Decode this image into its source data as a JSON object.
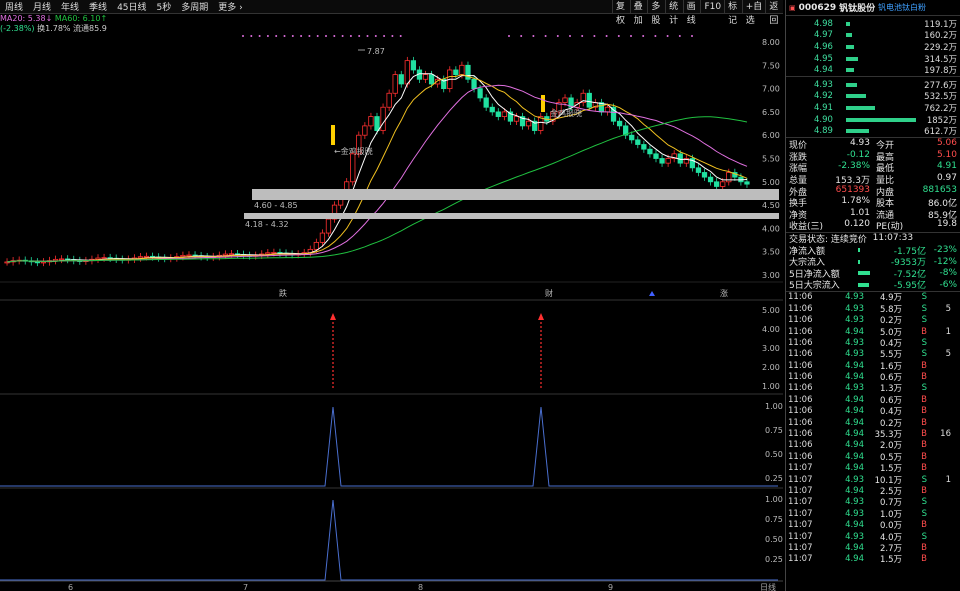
{
  "toolbar": {
    "periods": [
      "周线",
      "月线",
      "年线",
      "季线",
      "45日线",
      "5秒",
      "多周期",
      "更多 ›"
    ],
    "right": [
      "复权",
      "叠加",
      "多股",
      "统计",
      "画线",
      "F10",
      "标记",
      "+自选",
      "返回"
    ]
  },
  "ma": {
    "ma20": "MA20: 5.38↓",
    "ma60": "MA60: 6.10↑",
    "line2a": "(-2.38%)",
    "line2b": "换1.78% 流通85.9"
  },
  "chart": {
    "price_axis": [
      "8.00",
      "7.50",
      "7.00",
      "6.50",
      "6.00",
      "5.50",
      "5.00",
      "4.50",
      "4.00",
      "3.50",
      "3.00"
    ],
    "x_labels": [
      "6",
      "7",
      "8",
      "9"
    ],
    "annot": {
      "hi": "7.87",
      "box1": "4.60 - 4.85",
      "box2": "4.18 - 4.32",
      "sig1": "←金鸡报晓",
      "sig2": "金鸡报晓"
    },
    "events": {
      "e1": "跌",
      "e2": "财",
      "e3": "涨"
    },
    "sub1_axis": [
      "5.00",
      "4.00",
      "3.00",
      "2.00",
      "1.00"
    ],
    "sub2_axis": [
      "1.00",
      "0.75",
      "0.50",
      "0.25"
    ],
    "sub3_axis": [
      "1.00",
      "0.75",
      "0.50",
      "0.25"
    ],
    "bottom_label": "日线"
  },
  "colors": {
    "up": "#ff3030",
    "down": "#20e0a0",
    "ma5": "#ffffff",
    "ma10": "#f0c020",
    "ma20": "#e070e0",
    "ma60": "#20c040",
    "signal": "#ffd000",
    "box": "#bdbdbd",
    "line": "#4a6fd0"
  },
  "quote": {
    "code": "000629",
    "name": "钒钛股份",
    "tag": "钒电池钛白粉",
    "sells": [
      {
        "p": "4.98",
        "v": "119.1万",
        "w": 0.06
      },
      {
        "p": "4.97",
        "v": "160.2万",
        "w": 0.08
      },
      {
        "p": "4.96",
        "v": "229.2万",
        "w": 0.12
      },
      {
        "p": "4.95",
        "v": "314.5万",
        "w": 0.17
      },
      {
        "p": "4.94",
        "v": "197.8万",
        "w": 0.11
      }
    ],
    "buys": [
      {
        "p": "4.93",
        "v": "277.6万",
        "w": 0.15
      },
      {
        "p": "4.92",
        "v": "532.5万",
        "w": 0.29
      },
      {
        "p": "4.91",
        "v": "762.2万",
        "w": 0.41
      },
      {
        "p": "4.90",
        "v": "1852万",
        "w": 1.0
      },
      {
        "p": "4.89",
        "v": "612.7万",
        "w": 0.33
      }
    ],
    "stats": [
      [
        "现价",
        "4.93",
        "今开",
        "5.06"
      ],
      [
        "涨跌",
        "-0.12",
        "最高",
        "5.10"
      ],
      [
        "涨幅",
        "-2.38%",
        "最低",
        "4.91"
      ],
      [
        "总量",
        "153.3万",
        "量比",
        "0.97"
      ],
      [
        "外盘",
        "651393",
        "内盘",
        "881653"
      ],
      [
        "换手",
        "1.78%",
        "股本",
        "86.0亿"
      ],
      [
        "净资",
        "1.01",
        "流通",
        "85.9亿"
      ],
      [
        "收益(三)",
        "0.120",
        "PE(动)",
        "19.8"
      ]
    ],
    "trade_state": "交易状态: 连续竞价",
    "trade_time": "11:07:33",
    "flows": [
      [
        "净流入额",
        "-1.75亿",
        "-23%",
        0.1
      ],
      [
        "大宗流入",
        "-9353万",
        "-12%",
        0.05
      ],
      [
        "5日净流入额",
        "-7.52亿",
        "-8%",
        0.6
      ],
      [
        "5日大宗流入",
        "-5.95亿",
        "-6%",
        0.55
      ]
    ],
    "ticks": [
      [
        "11:06",
        "4.93",
        "4.9万",
        "S",
        ""
      ],
      [
        "11:06",
        "4.93",
        "5.8万",
        "S",
        "5"
      ],
      [
        "11:06",
        "4.93",
        "0.2万",
        "S",
        ""
      ],
      [
        "11:06",
        "4.94",
        "5.0万",
        "B",
        "1"
      ],
      [
        "11:06",
        "4.93",
        "0.4万",
        "S",
        ""
      ],
      [
        "11:06",
        "4.93",
        "5.5万",
        "S",
        "5"
      ],
      [
        "11:06",
        "4.94",
        "1.6万",
        "B",
        ""
      ],
      [
        "11:06",
        "4.94",
        "0.6万",
        "B",
        ""
      ],
      [
        "11:06",
        "4.93",
        "1.3万",
        "S",
        ""
      ],
      [
        "11:06",
        "4.94",
        "0.6万",
        "B",
        ""
      ],
      [
        "11:06",
        "4.94",
        "0.4万",
        "B",
        ""
      ],
      [
        "11:06",
        "4.94",
        "0.2万",
        "B",
        ""
      ],
      [
        "11:06",
        "4.94",
        "35.3万",
        "B",
        "16"
      ],
      [
        "11:06",
        "4.94",
        "2.0万",
        "B",
        ""
      ],
      [
        "11:06",
        "4.94",
        "0.5万",
        "B",
        ""
      ],
      [
        "11:07",
        "4.94",
        "1.5万",
        "B",
        ""
      ],
      [
        "11:07",
        "4.93",
        "10.1万",
        "S",
        "1"
      ],
      [
        "11:07",
        "4.94",
        "2.5万",
        "B",
        ""
      ],
      [
        "11:07",
        "4.93",
        "0.7万",
        "S",
        ""
      ],
      [
        "11:07",
        "4.93",
        "1.0万",
        "S",
        ""
      ],
      [
        "11:07",
        "4.94",
        "0.0万",
        "B",
        ""
      ],
      [
        "11:07",
        "4.93",
        "4.0万",
        "S",
        ""
      ],
      [
        "11:07",
        "4.94",
        "2.7万",
        "B",
        ""
      ],
      [
        "11:07",
        "4.94",
        "1.5万",
        "B",
        ""
      ]
    ]
  }
}
